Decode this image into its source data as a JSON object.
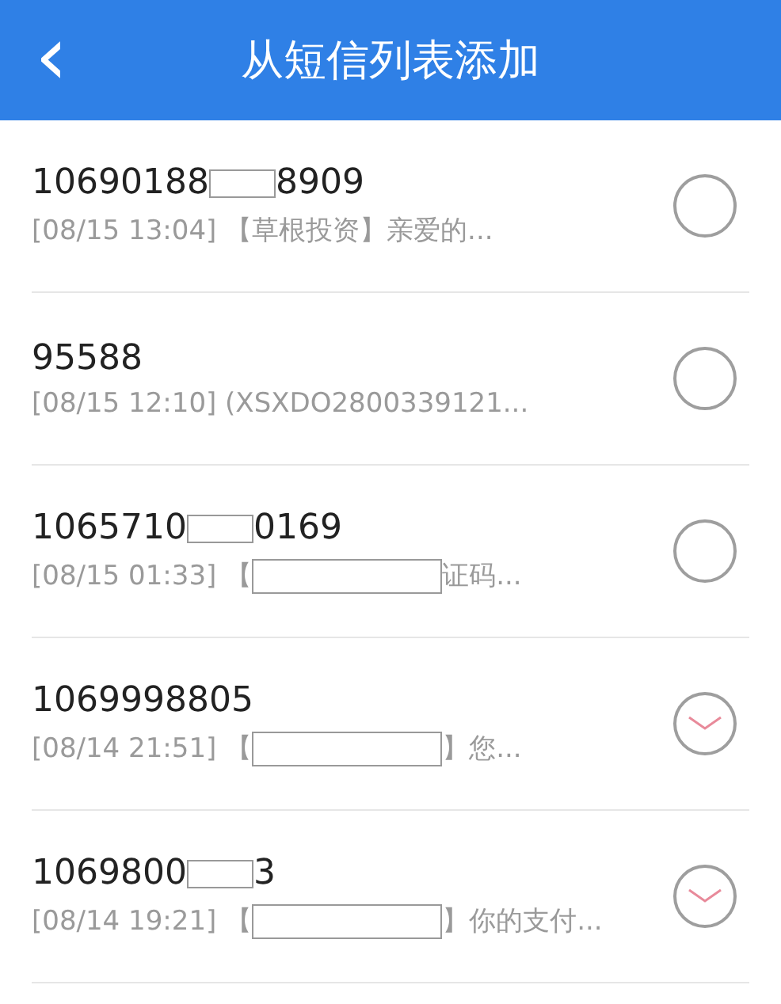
{
  "header": {
    "back_icon": "‹",
    "title": "从短信列表添加"
  },
  "messages": [
    {
      "number": [
        "10690188",
        "8909"
      ],
      "preview": [
        "[08/15 13:04] 【草根投资】亲爱的..."
      ],
      "selected": false
    },
    {
      "number": [
        "95588"
      ],
      "preview": [
        "[08/15 12:10] (XSXDO2800339121..."
      ],
      "selected": false
    },
    {
      "number": [
        "1065710",
        "0169"
      ],
      "preview": [
        "[08/15 01:33] 【",
        "证码..."
      ],
      "selected": false
    },
    {
      "number": [
        "1069998805"
      ],
      "preview": [
        "[08/14 21:51] 【",
        "】您..."
      ],
      "selected": true
    },
    {
      "number": [
        "1069800",
        "3"
      ],
      "preview": [
        "[08/14 19:21] 【",
        "】你的支付..."
      ],
      "selected": true
    }
  ]
}
